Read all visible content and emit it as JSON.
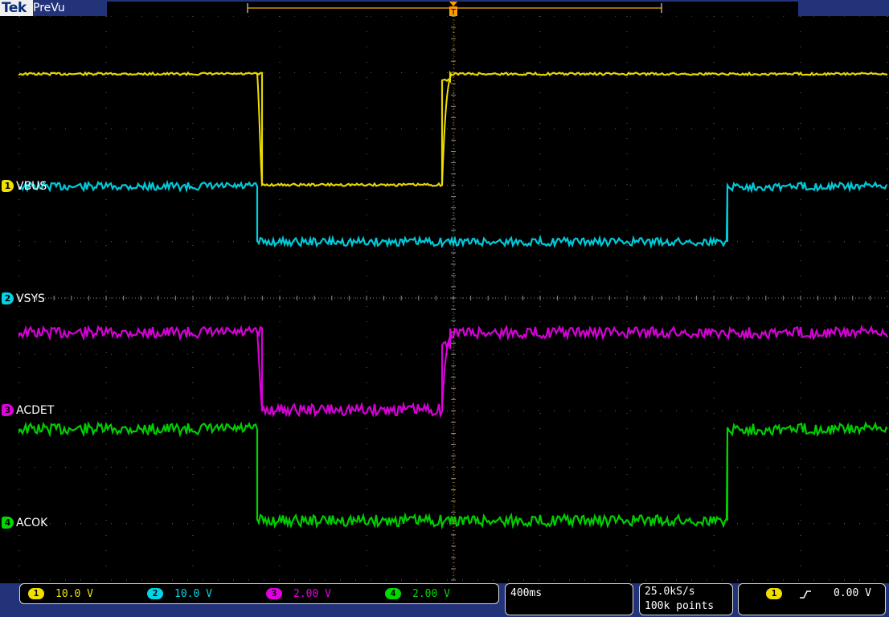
{
  "brand": "Tek",
  "mode": "PreVu",
  "trigger_marker": "T",
  "channels": [
    {
      "id": "1",
      "label": "VBUS",
      "color": "#f0e000",
      "scale": "10.0 V"
    },
    {
      "id": "2",
      "label": "VSYS",
      "color": "#00d4e5",
      "scale": "10.0 V"
    },
    {
      "id": "3",
      "label": "ACDET",
      "color": "#e000e0",
      "scale": "2.00 V"
    },
    {
      "id": "4",
      "label": "ACOK",
      "color": "#00d800",
      "scale": "2.00 V"
    }
  ],
  "timebase": "400ms",
  "sample_rate": "25.0kS/s",
  "record_length": "100k points",
  "trigger": {
    "channel": "1",
    "slope_icon": "rising-edge",
    "level": "0.00 V"
  },
  "colors": {
    "background": "#2b3f86",
    "screen": "#000000",
    "grid": "#8b8b8b",
    "trigger": "#ff9900",
    "panel_border": "#d9d9d9"
  }
}
